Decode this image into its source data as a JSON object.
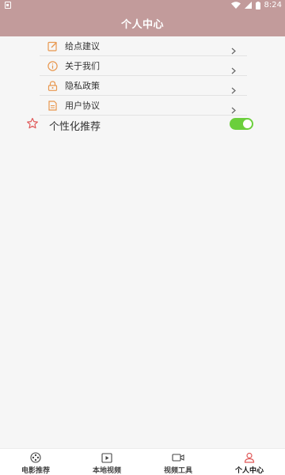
{
  "status_bar": {
    "time": "8:24"
  },
  "header": {
    "title": "个人中心"
  },
  "menu": [
    {
      "label": "给点建议",
      "icon": "edit-icon"
    },
    {
      "label": "关于我们",
      "icon": "info-icon"
    },
    {
      "label": "隐私政策",
      "icon": "lock-icon"
    },
    {
      "label": "用户协议",
      "icon": "document-icon"
    }
  ],
  "personalized": {
    "label": "个性化推荐",
    "icon": "star-icon",
    "enabled": true
  },
  "tabs": [
    {
      "label": "电影推荐",
      "icon": "film-reel-icon",
      "active": false
    },
    {
      "label": "本地视频",
      "icon": "video-file-icon",
      "active": false
    },
    {
      "label": "视频工具",
      "icon": "video-camera-icon",
      "active": false
    },
    {
      "label": "个人中心",
      "icon": "person-icon",
      "active": true
    }
  ],
  "colors": {
    "header_bg": "#c29b9b",
    "icon_orange": "#e8974e",
    "toggle_on": "#6bcf3c",
    "accent_red": "#e05a5a"
  }
}
